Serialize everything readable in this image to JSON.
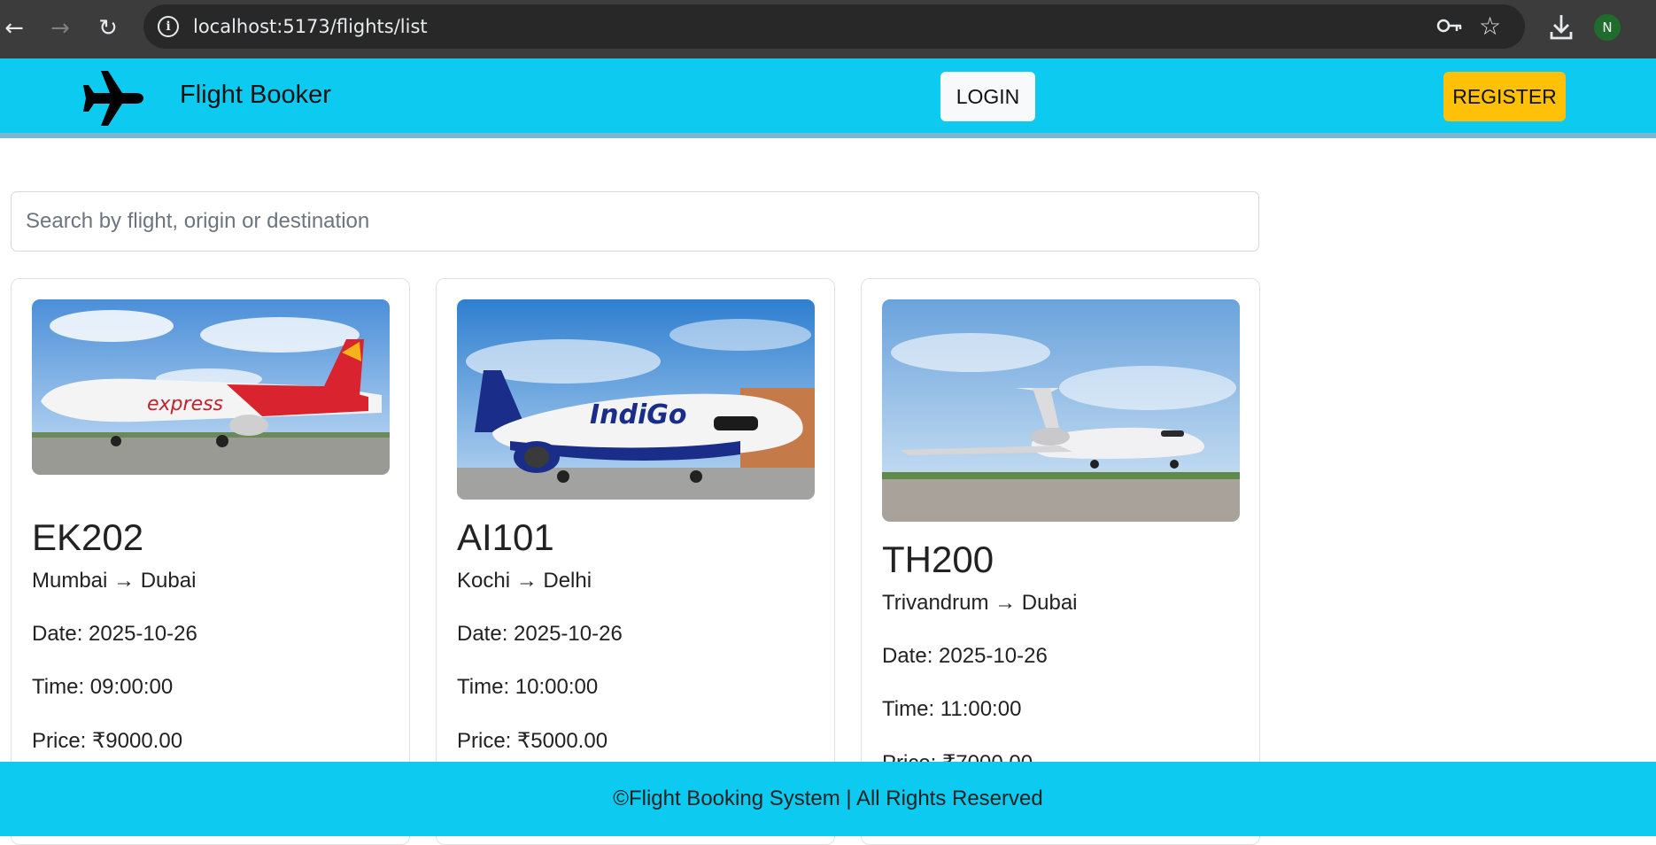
{
  "browser": {
    "url": "localhost:5173/flights/list",
    "profile_initial": "N"
  },
  "navbar": {
    "brand": "Flight Booker",
    "login_label": "LOGIN",
    "register_label": "REGISTER"
  },
  "search": {
    "placeholder": "Search by flight, origin or destination"
  },
  "flights": [
    {
      "code": "EK202",
      "route": "Mumbai → Dubai",
      "date": "Date: 2025-10-26",
      "time": "Time: 09:00:00",
      "price": "Price: ₹9000.00",
      "image": "air-india-express-plane"
    },
    {
      "code": "AI101",
      "route": "Kochi → Delhi",
      "date": "Date: 2025-10-26",
      "time": "Time: 10:00:00",
      "price": "Price: ₹5000.00",
      "image": "indigo-plane"
    },
    {
      "code": "TH200",
      "route": "Trivandrum → Dubai",
      "date": "Date: 2025-10-26",
      "time": "Time: 11:00:00",
      "price": "Price: ₹7000.00",
      "image": "private-jet"
    }
  ],
  "footer": {
    "text": "©Flight Booking System | All Rights Reserved"
  },
  "colors": {
    "navbar_bg": "#0dcaf0",
    "register_bg": "#ffc107",
    "login_bg": "#f8f9fa"
  }
}
